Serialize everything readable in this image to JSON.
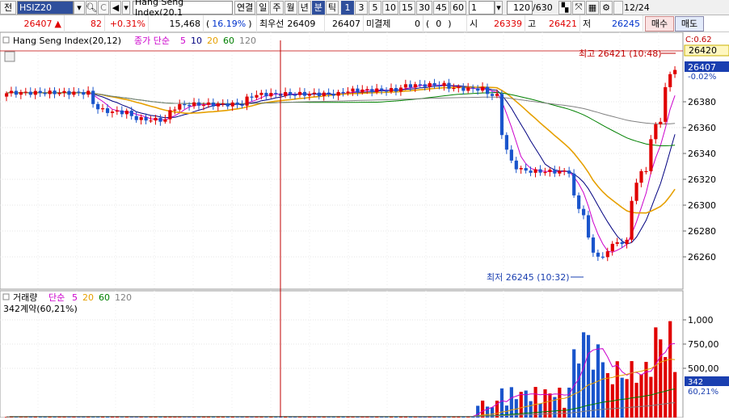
{
  "toolbar": {
    "prefix": "전",
    "symbol": "HSIZ20",
    "title": "Hang Seng Index(20.1",
    "period_buttons": [
      "연결",
      "일",
      "주",
      "월",
      "년",
      "분",
      "틱"
    ],
    "interval_buttons": [
      "1",
      "3",
      "5",
      "10",
      "15",
      "30",
      "45",
      "60"
    ],
    "interval_value": "1",
    "count": "120",
    "total": "/630",
    "date": "12/24"
  },
  "quote": {
    "price": "26407",
    "change": "82",
    "change_pct": "+0.31%",
    "volume": "15,468",
    "open_paren": "(",
    "volume_pct": "16.19%",
    "close_paren": ")",
    "best_label": "최우선",
    "best_bid": "26409",
    "best_ask": "26407",
    "open_int_label": "미결제",
    "open_int": "0",
    "oi_open": "(",
    "oi_change": "0",
    "oi_close": ")",
    "open_label": "시",
    "open": "26339",
    "high_label": "고",
    "high": "26421",
    "low_label": "저",
    "low": "26245",
    "buy_button": "매수",
    "sell_button": "매도"
  },
  "price_panel": {
    "legend_name": "Hang Seng Index(20,12)",
    "legend_ma_label": "종가 단순",
    "legend_ma": [
      "5",
      "10",
      "20",
      "60",
      "120"
    ],
    "legend_ma_colors": [
      "#cc00cc",
      "#000080",
      "#e6a000",
      "#008000",
      "#808080"
    ],
    "high_annotation": "최고 26421 (10:48)",
    "low_annotation": "최저 26245 (10:32)",
    "corner_label": "C:0.62",
    "last_price_box": "26420",
    "current_price_box": "26407",
    "current_pct": "-0.02%",
    "y_ticks": [
      "26380",
      "26360",
      "26340",
      "26320",
      "26300",
      "26280",
      "26260"
    ]
  },
  "volume_panel": {
    "legend_name": "거래량",
    "legend_ma_label": "단순",
    "legend_ma": [
      "5",
      "20",
      "60",
      "120"
    ],
    "legend_ma_colors": [
      "#cc00cc",
      "#e6a000",
      "#008000",
      "#808080"
    ],
    "sub_label": "342계약(60,21%)",
    "y_ticks": [
      "1,000",
      "750,00",
      "500,00"
    ],
    "current_box": "342",
    "current_pct": "60,21%"
  },
  "colors": {
    "up": "#e00000",
    "down": "#1a55cc",
    "accent": "#2f4f9c"
  }
}
